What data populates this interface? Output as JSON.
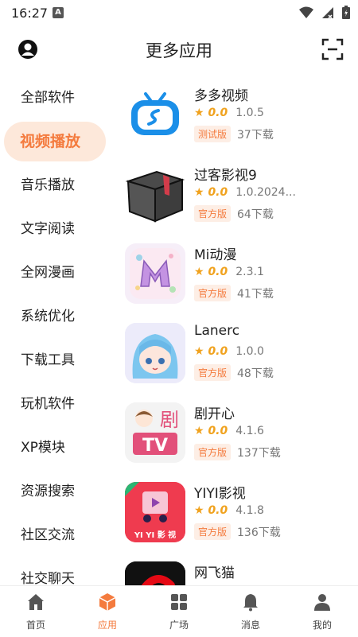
{
  "status": {
    "time": "16:27",
    "a_icon": "A"
  },
  "header": {
    "title": "更多应用",
    "left_icon": "user-circle-icon",
    "right_icon": "scan-icon"
  },
  "categories": [
    {
      "label": "全部软件",
      "active": false
    },
    {
      "label": "视频播放",
      "active": true
    },
    {
      "label": "音乐播放",
      "active": false
    },
    {
      "label": "文字阅读",
      "active": false
    },
    {
      "label": "全网漫画",
      "active": false
    },
    {
      "label": "系统优化",
      "active": false
    },
    {
      "label": "下载工具",
      "active": false
    },
    {
      "label": "玩机软件",
      "active": false
    },
    {
      "label": "XP模块",
      "active": false
    },
    {
      "label": "资源搜索",
      "active": false
    },
    {
      "label": "社区交流",
      "active": false
    },
    {
      "label": "社交聊天",
      "active": false
    }
  ],
  "apps": [
    {
      "name": "多多视频",
      "rating": "0.0",
      "version": "1.0.5",
      "badge": "测试版",
      "downloads": "37下载"
    },
    {
      "name": "过客影视9",
      "rating": "0.0",
      "version": "1.0.2024...",
      "badge": "官方版",
      "downloads": "64下载"
    },
    {
      "name": "Mi动漫",
      "rating": "0.0",
      "version": "2.3.1",
      "badge": "官方版",
      "downloads": "41下载"
    },
    {
      "name": "Lanerc",
      "rating": "0.0",
      "version": "1.0.0",
      "badge": "官方版",
      "downloads": "48下载"
    },
    {
      "name": "剧开心",
      "rating": "0.0",
      "version": "4.1.6",
      "badge": "官方版",
      "downloads": "137下载",
      "icon_text": "剧",
      "icon_text2": "TV"
    },
    {
      "name": "YIYI影视",
      "rating": "0.0",
      "version": "4.1.8",
      "badge": "官方版",
      "downloads": "136下载",
      "icon_text": "YI YI 影 视"
    },
    {
      "name": "网飞猫"
    }
  ],
  "tabs": [
    {
      "label": "首页",
      "icon": "home-icon",
      "active": false
    },
    {
      "label": "应用",
      "icon": "apps-cube-icon",
      "active": true
    },
    {
      "label": "广场",
      "icon": "grid-icon",
      "active": false
    },
    {
      "label": "消息",
      "icon": "bell-icon",
      "active": false
    },
    {
      "label": "我的",
      "icon": "person-icon",
      "active": false
    }
  ],
  "colors": {
    "accent": "#f47b3e",
    "accent_bg": "#fde8da",
    "star": "#f0a21e"
  }
}
